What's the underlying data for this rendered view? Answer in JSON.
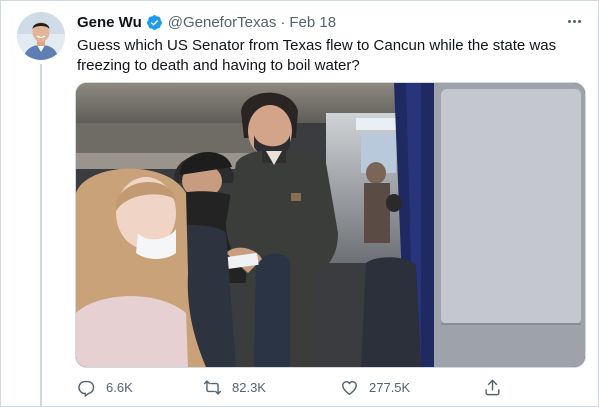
{
  "author": {
    "display_name": "Gene Wu",
    "handle": "@GeneforTexas",
    "separator": "·",
    "date": "Feb 18",
    "verified": true
  },
  "tweet": {
    "text": "Guess which US Senator from Texas flew to Cancun while the state was freezing to death and having to boil water?"
  },
  "actions": {
    "reply_count": "6.6K",
    "retweet_count": "82.3K",
    "like_count": "277.5K"
  },
  "icons": {
    "verified": "verified-badge-icon",
    "more": "more-options-icon",
    "reply": "reply-icon",
    "retweet": "retweet-icon",
    "like": "heart-icon",
    "share": "share-icon"
  },
  "colors": {
    "verified_blue": "#1d9bf0",
    "secondary_text": "#536471",
    "border": "#cfd9de"
  }
}
